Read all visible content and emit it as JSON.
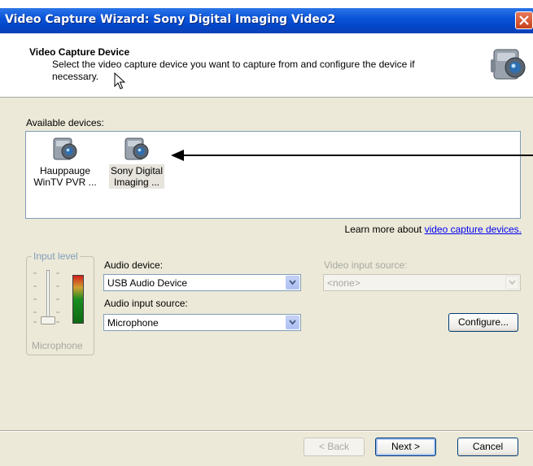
{
  "window": {
    "title": "Video Capture Wizard: Sony Digital Imaging Video2"
  },
  "header": {
    "title": "Video Capture Device",
    "description": "Select the video capture device you want to capture from and configure the device if necessary."
  },
  "devices": {
    "label": "Available devices:",
    "items": [
      {
        "label_line1": "Hauppauge",
        "label_line2": "WinTV PVR ...",
        "selected": false
      },
      {
        "label_line1": "Sony Digital",
        "label_line2": "Imaging ...",
        "selected": true
      }
    ]
  },
  "learn_more": {
    "prefix": "Learn more about ",
    "link": "video capture devices."
  },
  "input_level": {
    "title": "Input level",
    "caption": "Microphone"
  },
  "audio_device": {
    "label": "Audio device:",
    "value": "USB Audio Device"
  },
  "audio_input_source": {
    "label": "Audio input source:",
    "value": "Microphone"
  },
  "video_input_source": {
    "label": "Video input source:",
    "value": "<none>"
  },
  "buttons": {
    "configure": "Configure...",
    "back": "< Back",
    "next": "Next >",
    "cancel": "Cancel"
  },
  "colors": {
    "titlebar": "#0a54d9",
    "link": "#0000ee",
    "disabled_text": "#a8a8a0",
    "dialog_bg": "#ece9d8"
  },
  "icons": {
    "close": "close-icon",
    "camera": "video-camera-icon",
    "arrow": "pointer-arrow-icon",
    "dropdown": "chevron-down-icon"
  }
}
